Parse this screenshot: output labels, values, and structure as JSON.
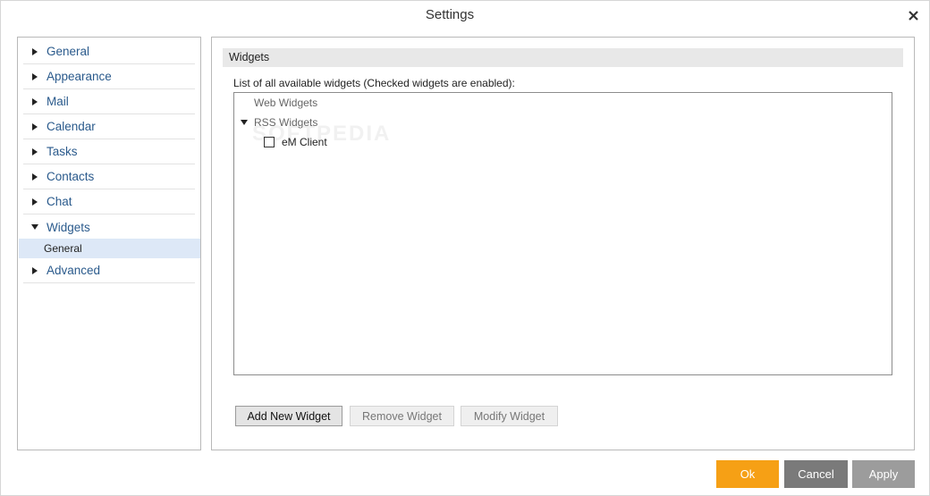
{
  "window": {
    "title": "Settings"
  },
  "nav": {
    "items": [
      {
        "label": "General",
        "expanded": false
      },
      {
        "label": "Appearance",
        "expanded": false
      },
      {
        "label": "Mail",
        "expanded": false
      },
      {
        "label": "Calendar",
        "expanded": false
      },
      {
        "label": "Tasks",
        "expanded": false
      },
      {
        "label": "Contacts",
        "expanded": false
      },
      {
        "label": "Chat",
        "expanded": false
      },
      {
        "label": "Widgets",
        "expanded": true
      },
      {
        "label": "Advanced",
        "expanded": false
      }
    ],
    "selected_sub": "General"
  },
  "panel": {
    "section_title": "Widgets",
    "list_caption": "List of all available widgets (Checked widgets are enabled):",
    "tree": {
      "web_widgets": "Web Widgets",
      "rss_widgets": "RSS Widgets",
      "rss_children": [
        {
          "label": "eM Client",
          "checked": false
        }
      ]
    },
    "watermark": "SOFTPEDIA",
    "buttons": {
      "add": "Add New Widget",
      "remove": "Remove Widget",
      "modify": "Modify Widget"
    }
  },
  "footer": {
    "ok": "Ok",
    "cancel": "Cancel",
    "apply": "Apply"
  },
  "colors": {
    "accent_ok": "#f6a015",
    "nav_text": "#2a5a8c",
    "selected_bg": "#dde8f7"
  }
}
